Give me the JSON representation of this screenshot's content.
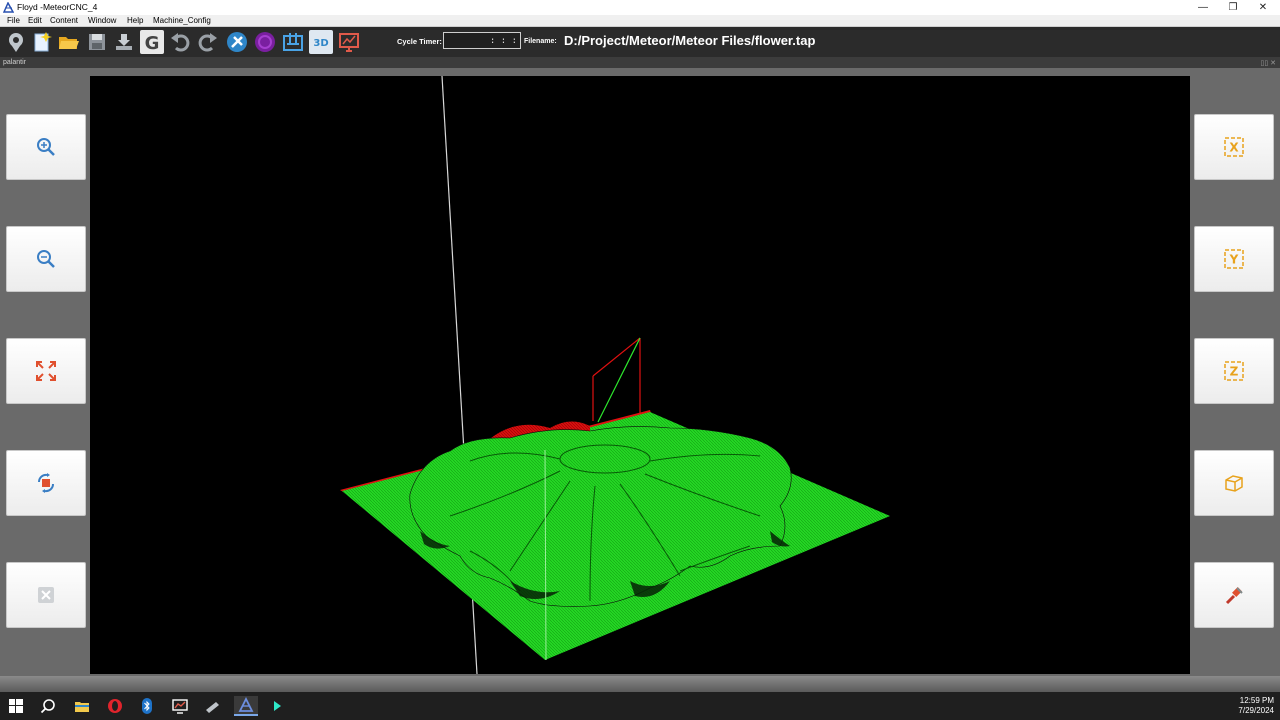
{
  "window": {
    "title": "Floyd -MeteorCNC_4",
    "controls": [
      "—",
      "❐",
      "✕"
    ]
  },
  "menu": [
    "File",
    "Edit",
    "Content",
    "Window",
    "Help",
    "Machine_Config"
  ],
  "toolbar": {
    "cycle_timer_label": "Cycle Timer:",
    "cycle_timer_value": "  :  :  :  ",
    "filename_label": "Filename:",
    "filename_value": "D:/Project/Meteor/Meteor Files/flower.tap",
    "g_label": "G",
    "three_d_label": "3D",
    "icons": [
      "location-icon",
      "new-file-icon",
      "open-folder-icon",
      "save-icon",
      "download-icon",
      "gcode-icon",
      "undo-icon",
      "redo-icon",
      "tools-icon",
      "circle-icon",
      "machine-icon",
      "3d-view-icon",
      "monitor-icon"
    ]
  },
  "panel": {
    "label": "palantir",
    "corner": "▯▯ ✕"
  },
  "left_buttons": [
    "zoom-in-icon",
    "zoom-out-icon",
    "fit-view-icon",
    "rotate-icon",
    "close-icon"
  ],
  "right_buttons": [
    "x-axis-view-icon",
    "y-axis-view-icon",
    "z-axis-view-icon",
    "iso-view-icon",
    "tool-icon"
  ],
  "right_button_letters": [
    "X",
    "Y",
    "Z"
  ],
  "colors": {
    "toolpath": "#2ee82e",
    "rapid": "#e01010",
    "axis_buttons": "#e8a21c",
    "viewport_bg": "#000000"
  },
  "taskbar": {
    "icons": [
      "windows-start-icon",
      "search-icon",
      "file-explorer-icon",
      "opera-icon",
      "bluetooth-icon",
      "monitor-app-icon",
      "tool-app-icon",
      "meteor-app-icon",
      "terminal-app-icon"
    ],
    "time": "12:59 PM",
    "date": "7/29/2024"
  }
}
